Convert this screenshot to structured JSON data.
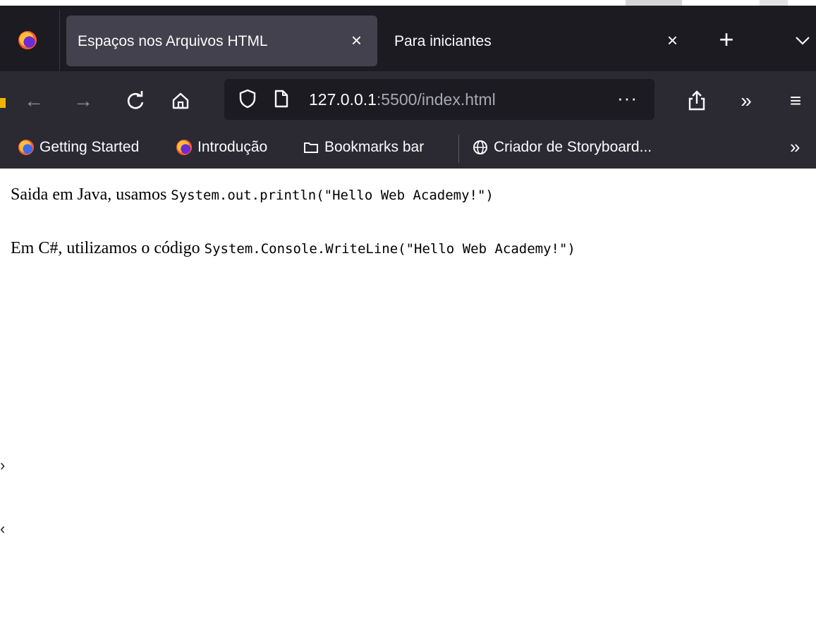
{
  "browser": {
    "tabs": [
      {
        "title": "Espaços nos Arquivos HTML",
        "close": "×",
        "active": true
      },
      {
        "title": "Para iniciantes",
        "close": "×",
        "active": false
      }
    ],
    "new_tab": "+",
    "tab_list": "⌄",
    "nav": {
      "back": "←",
      "forward": "→",
      "reload": "C",
      "home": "⌂",
      "url_host": "127.0.0.1",
      "url_rest": ":5500/index.html",
      "page_actions": "···",
      "extensions": "»",
      "menu": "≡"
    },
    "bookmarks": [
      {
        "label": "Getting Started"
      },
      {
        "label": "Introdução"
      },
      {
        "label": "Bookmarks bar"
      },
      {
        "label": "Criador de Storyboard..."
      }
    ],
    "bookmarks_overflow": "»"
  },
  "page": {
    "line1_text": "Saida em Java, usamos ",
    "line1_code": "System.out.println(\"Hello Web Academy!\")",
    "line2_text": "Em C#, utilizamos o código ",
    "line2_code": "System.Console.WriteLine(\"Hello Web Academy!\")"
  },
  "colors": {
    "tabstrip": "#1c1b22",
    "toolbar": "#2b2a33",
    "active_tab": "#42414d",
    "text_light": "#fbfbfe"
  }
}
